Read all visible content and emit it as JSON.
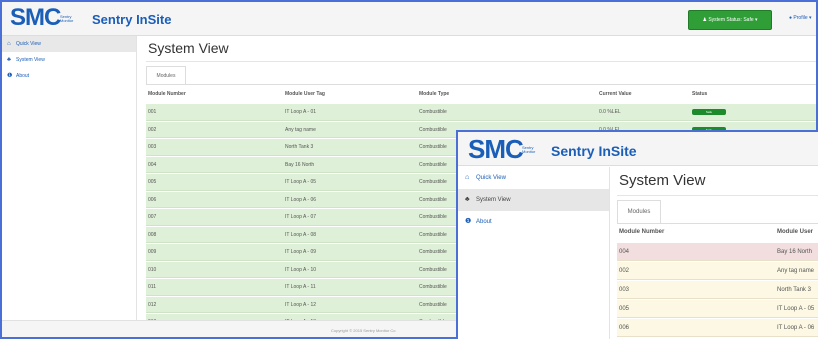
{
  "app": {
    "logo_text": "SMC",
    "logo_subtext": "Sentry Monitor",
    "title": "Sentry InSite"
  },
  "header": {
    "system_status_label": "System Status: Safe ▾",
    "profile_label": "Profile ▾"
  },
  "sidebar": {
    "items": [
      {
        "label": "Quick View",
        "icon": "home-icon"
      },
      {
        "label": "System View",
        "icon": "sitemap-icon"
      },
      {
        "label": "About",
        "icon": "info-icon"
      }
    ]
  },
  "main": {
    "page_title": "System View",
    "tab_label": "Modules",
    "table": {
      "columns": [
        "Module Number",
        "Module User Tag",
        "Module Type",
        "Current Value",
        "Status"
      ],
      "rows": [
        {
          "number": "001",
          "tag": "IT Loop A - 01",
          "type": "Combustible",
          "value": "0.0 %LEL",
          "status": "Safe"
        },
        {
          "number": "002",
          "tag": "Any tag name",
          "type": "Combustible",
          "value": "0.0 %LEL",
          "status": "Safe"
        },
        {
          "number": "003",
          "tag": "North Tank 3",
          "type": "Combustible"
        },
        {
          "number": "004",
          "tag": "Bay 16 North",
          "type": "Combustible"
        },
        {
          "number": "005",
          "tag": "IT Loop A - 05",
          "type": "Combustible"
        },
        {
          "number": "006",
          "tag": "IT Loop A - 06",
          "type": "Combustible"
        },
        {
          "number": "007",
          "tag": "IT Loop A - 07",
          "type": "Combustible"
        },
        {
          "number": "008",
          "tag": "IT Loop A - 08",
          "type": "Combustible"
        },
        {
          "number": "009",
          "tag": "IT Loop A - 09",
          "type": "Combustible"
        },
        {
          "number": "010",
          "tag": "IT Loop A - 10",
          "type": "Combustible"
        },
        {
          "number": "011",
          "tag": "IT Loop A - 11",
          "type": "Combustible"
        },
        {
          "number": "012",
          "tag": "IT Loop A - 12",
          "type": "Combustible"
        },
        {
          "number": "013",
          "tag": "IT Loop A - 13",
          "type": "Combustible"
        }
      ]
    }
  },
  "footer": {
    "text": "Copyright © 2015 Sentry Monitor Co"
  },
  "zoom_inset": {
    "columns": [
      "Module Number",
      "Module User"
    ],
    "rows": [
      {
        "number": "004",
        "tag": "Bay 16 North",
        "state": "alarm"
      },
      {
        "number": "002",
        "tag": "Any tag name",
        "state": "warning"
      },
      {
        "number": "003",
        "tag": "North Tank 3",
        "state": "warning"
      },
      {
        "number": "005",
        "tag": "IT Loop A - 05",
        "state": "warning"
      },
      {
        "number": "006",
        "tag": "IT Loop A - 06",
        "state": "warning"
      }
    ]
  },
  "colors": {
    "brand_blue": "#1a5eb8",
    "safe_green": "#2f9e37",
    "row_safe": "#dff0d8",
    "row_alarm": "#f2dede",
    "row_warning": "#fcf8e3"
  }
}
